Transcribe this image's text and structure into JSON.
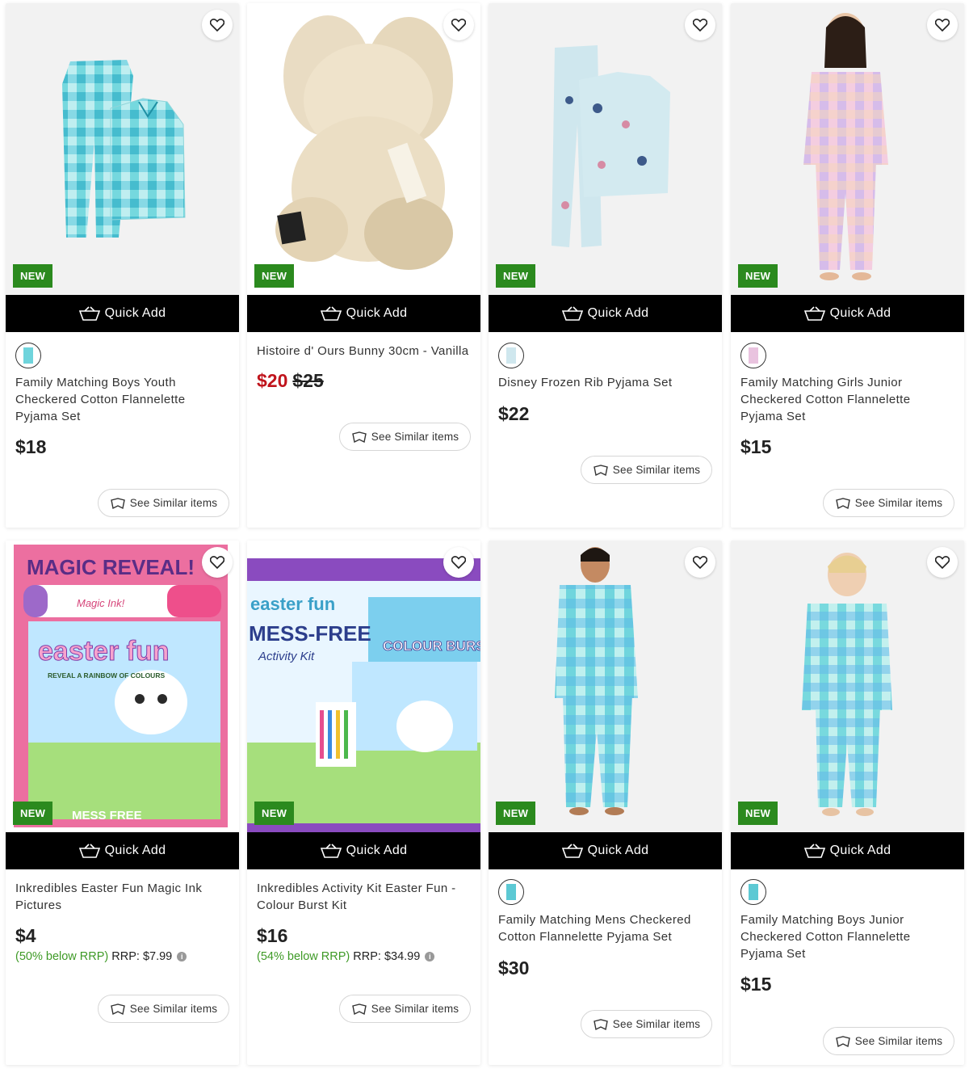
{
  "quick_add_label": "Quick Add",
  "see_similar_label": "See Similar items",
  "new_label": "NEW",
  "colors": {
    "new_badge": "#2b8a1e",
    "sale_price": "#c0141c",
    "below_rrp": "#3e9a26",
    "quick_add_bg": "#000000"
  },
  "products": [
    {
      "title": "Family Matching Boys Youth Checkered Cotton Flannelette Pyjama Set",
      "price": "$18",
      "icon": "turquoise-check-pyjama"
    },
    {
      "title": "Histoire d' Ours Bunny 30cm - Vanilla",
      "price": "$20",
      "was_price": "$25",
      "icon": "plush-bunny"
    },
    {
      "title": "Disney Frozen Rib Pyjama Set",
      "price": "$22",
      "icon": "blue-frozen-pyjama"
    },
    {
      "title": "Family Matching Girls Junior Checkered Cotton Flannelette Pyjama Set",
      "price": "$15",
      "icon": "pastel-check-pyjama"
    },
    {
      "title": "Inkredibles Easter Fun Magic Ink Pictures",
      "price": "$4",
      "below_rrp": "(50% below RRP)",
      "rrp": "RRP: $7.99",
      "icon": "magic-reveal-book",
      "art_text": {
        "top": "MAGIC REVEAL!",
        "pen": "Magic Ink!",
        "main": "easter fun",
        "sub": "REVEAL A RAINBOW OF COLOURS",
        "bottom": "MESS FREE"
      }
    },
    {
      "title": "Inkredibles Activity Kit Easter Fun - Colour Burst Kit",
      "price": "$16",
      "below_rrp": "(54% below RRP)",
      "rrp": "RRP: $34.99",
      "icon": "activity-kit-box",
      "art_text": {
        "top": "easter fun",
        "main": "MESS-FREE",
        "sub": "Activity Kit",
        "burst": "COLOUR BURST"
      }
    },
    {
      "title": "Family Matching Mens Checkered Cotton Flannelette Pyjama Set",
      "price": "$30",
      "icon": "mens-check-pyjama"
    },
    {
      "title": "Family Matching Boys Junior Checkered Cotton Flannelette Pyjama Set",
      "price": "$15",
      "icon": "boys-check-pyjama"
    }
  ]
}
